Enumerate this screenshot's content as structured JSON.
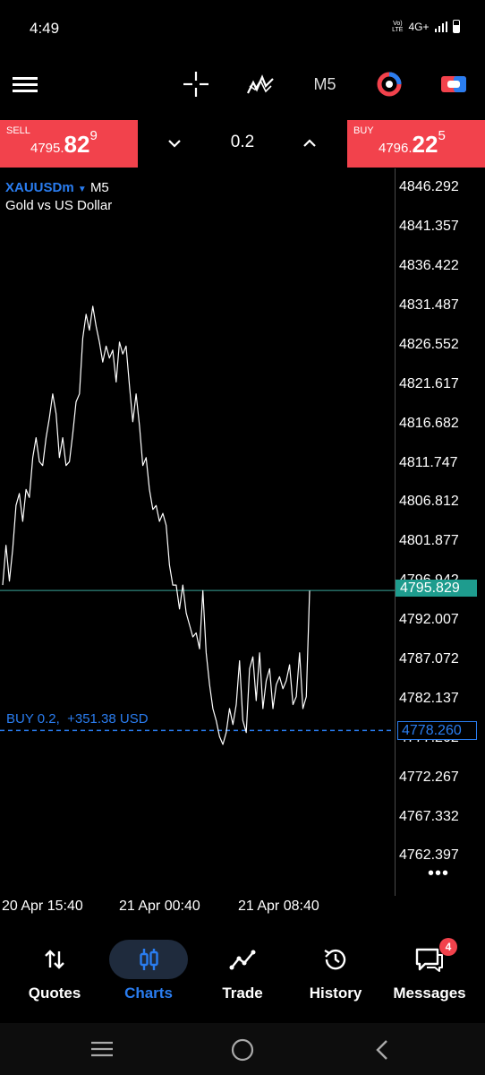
{
  "status_bar": {
    "time": "4:49",
    "volte": "Vo) LTE",
    "network": "4G+"
  },
  "toolbar": {
    "timeframe": "M5",
    "icons": [
      "menu-icon",
      "crosshair-icon",
      "indicators-icon",
      "timeframe",
      "chart-color-icon",
      "trade-toggle-icon"
    ]
  },
  "trade_bar": {
    "sell_label": "SELL",
    "sell_price_small": "4795.",
    "sell_price_big": "82",
    "sell_price_sup": "9",
    "buy_label": "BUY",
    "buy_price_small": "4796.",
    "buy_price_big": "22",
    "buy_price_sup": "5",
    "lot_size": "0.2"
  },
  "chart": {
    "symbol": "XAUUSDm",
    "timeframe": "M5",
    "description": "Gold vs US Dollar",
    "price_ticks": [
      "4846.292",
      "4841.357",
      "4836.422",
      "4831.487",
      "4826.552",
      "4821.617",
      "4816.682",
      "4811.747",
      "4806.812",
      "4801.877",
      "4796.942",
      "4792.007",
      "4787.072",
      "4782.137",
      "4777.202",
      "4772.267",
      "4767.332",
      "4762.397"
    ],
    "time_ticks": [
      "20 Apr 15:40",
      "21 Apr 00:40",
      "21 Apr 08:40"
    ],
    "current_price": "4795.829",
    "position_price": "4778.260",
    "position_label": "BUY 0.2,  +351.38 USD",
    "colors": {
      "line": "#ffffff",
      "bid_line": "#3aa59a",
      "bid_badge": "#1e9c8e",
      "position": "#2a7df0"
    }
  },
  "chart_data": {
    "type": "line",
    "title": "XAUUSDm",
    "xlabel": "",
    "ylabel": "",
    "x_ticks": [
      "20 Apr 15:40",
      "21 Apr 00:40",
      "21 Apr 08:40"
    ],
    "ylim": [
      4757.5,
      4848.8
    ],
    "series": [
      {
        "values": [
          4796.5,
          4801.5,
          4797.0,
          4801.0,
          4806.5,
          4808.0,
          4804.5,
          4808.5,
          4807.5,
          4812.5,
          4815.0,
          4812.0,
          4811.5,
          4815.0,
          4817.5,
          4820.5,
          4818.0,
          4812.5,
          4815.0,
          4811.5,
          4812.0,
          4815.5,
          4819.5,
          4820.5,
          4827.5,
          4830.5,
          4828.5,
          4831.5,
          4829.0,
          4827.0,
          4824.5,
          4826.5,
          4825.0,
          4826.0,
          4822.0,
          4827.0,
          4825.5,
          4826.5,
          4821.5,
          4817.0,
          4820.5,
          4816.5,
          4811.5,
          4812.5,
          4808.5,
          4806.0,
          4806.5,
          4804.5,
          4805.5,
          4804.0,
          4799.0,
          4796.5,
          4796.5,
          4793.5,
          4796.5,
          4793.0,
          4791.5,
          4790.0,
          4790.5,
          4788.5,
          4795.8,
          4788.0,
          4784.0,
          4781.0,
          4779.5,
          4777.5,
          4776.5,
          4778.0,
          4781.0,
          4779.0,
          4781.5,
          4787.0,
          4779.5,
          4778.0,
          4786.0,
          4787.5,
          4782.0,
          4788.0,
          4781.0,
          4784.5,
          4786.0,
          4781.0,
          4784.0,
          4785.0,
          4783.5,
          4784.5,
          4786.5,
          4781.5,
          4782.5,
          4788.0,
          4781.0,
          4782.5,
          4795.8
        ]
      }
    ]
  },
  "more_menu": "•••",
  "bottom_nav": {
    "items": [
      {
        "label": "Quotes",
        "icon": "quotes-icon"
      },
      {
        "label": "Charts",
        "icon": "charts-icon",
        "active": true
      },
      {
        "label": "Trade",
        "icon": "trade-icon"
      },
      {
        "label": "History",
        "icon": "history-icon"
      },
      {
        "label": "Messages",
        "icon": "messages-icon",
        "badge": "4"
      }
    ]
  }
}
